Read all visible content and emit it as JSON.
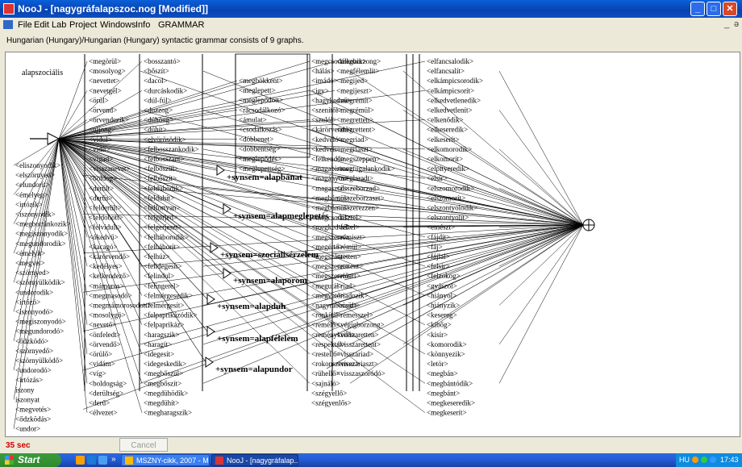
{
  "window": {
    "title": "NooJ - [nagygráfalapszoc.nog [Modified]]"
  },
  "menu": [
    "File",
    "Edit",
    "Lab",
    "Project",
    "Windows",
    "Info",
    "GRAMMAR"
  ],
  "mdi_controls": {
    "minimize": "_",
    "restore": "ə"
  },
  "info_text": "Hungarian (Hungary)/Hungarian (Hungary) syntactic grammar consists of 9 graphs.",
  "graph": {
    "start_label": "alapszociális",
    "columns": [
      [
        "<eliszonyodik>",
        "<elszörnyed>",
        "<elundorít>",
        "<émelyeg>",
        "<irtózik>",
        "<iszonyodik>",
        "<megbotránkozik>",
        "<megiszonyodik>",
        "<megundorodik>",
        "<émelyít>",
        "<megvet>",
        "<szörnyed>",
        "<szörnyülködik>",
        "<undorodik>",
        "<irtózó>",
        "<iszonyodó>",
        "<megiszonyodó>",
        "<megundorodó>",
        "<ődzködó>",
        "<szörnyedő>",
        "<szörnyülködő>",
        "<undorodó>",
        "<irtózás>",
        "iszony",
        "iszonyat",
        "<megvetés>",
        "<ődzködás>",
        "<undor>"
      ],
      [
        "<megörül>",
        "<mosolyog>",
        "<nevettet>",
        "<nevetgél>",
        "<örül>",
        "<örvend>",
        "<örvendezik>",
        "<ujjong>",
        "<vidul>",
        "<vidít>",
        "<vigad>",
        "<visszanevet>",
        "<boldog>",
        "<derült>",
        "<derűs>",
        "<felderült>",
        "<feldobott>",
        "<felvidult>",
        "<ókedvű>",
        "<kacagó>",
        "<kárörvendő>",
        "<kedélyes>",
        "<kelkendező>",
        "<mámoros>",
        "<megmasodó>",
        "<megmámorosodott>",
        "<mosolygó>",
        "<nevető>",
        "<önfeledt>",
        "<örvendő>",
        "<örülő>",
        "<vidám>",
        "<víg>",
        "<boldogság>",
        "<derültség>",
        "<derű>",
        "<élvezet>"
      ],
      [
        "<bosszantó>",
        "<bőszít>",
        "<dacol>",
        "<durcáskodik>",
        "<dúl-fúl>",
        "<duzzog>",
        "<dühöng>",
        "<dühít>",
        "<elvörösödik>",
        "<felbosszankodik>",
        "<felbosszant>",
        "<felbőszül>",
        "<felbőszít>",
        "<feldühödik>",
        "<felduhít>",
        "<felfortyan>",
        "<felgerjed>",
        "<felgerjeszt>",
        "<felháborodik>",
        "<felháborít>",
        "<felhúz>",
        "<felidegesít>",
        "<felindul>",
        "<felingerel>",
        "<felmérgesedik>",
        "<felmérgesít>",
        "<felpaprikázódik>",
        "<felpaprikáz>",
        "<haragszik>",
        "<haragít>",
        "<idegesít>",
        "<idegeskedik>",
        "<megbőszül>",
        "<megbőszít>",
        "<megdühödik>",
        "<megdühít>",
        "<megharagszik>"
      ],
      [
        "<megbökkent>",
        "<meglepett>",
        "<meglepődött>",
        "<rácsodálkozó>",
        "<ámulat>",
        "<csodálkozás>",
        "<döbbenet>",
        "<döbbentség>",
        "<meglepődés>",
        "<meglepettség>"
      ],
      [
        "<megcsodálkozik>",
        "<hálás>",
        "<imádó>",
        "<igy>",
        "<hagykedvű>",
        "<szenitől>",
        "<szulól>",
        "<kárörvendő>",
        "<kedveló>",
        "<kedvelt>",
        "<feikendő>",
        "<magabiztos>",
        "<magányos>",
        "<magasztal>",
        "<megbámul>",
        "<megbámul>",
        "<megcsodál>",
        "<megkedvel>",
        "<megszeret>",
        "<megértő>",
        "<megszánt>",
        "<megszeret>",
        "<megszerető>",
        "<megutál>",
        "<megvető>",
        "<nagyrabecsül>",
        "<ronkítál>",
        "<remélő>",
        "<reménykedő>",
        "<respektál>",
        "<restellő>",
        "<rokonszenvez>",
        "<rühellő>",
        "<sajnáló>",
        "<szégyellő>",
        "<szégyenlős>"
      ],
      [
        "<megborzong>",
        "<megfélemlít>",
        "<megijed>",
        "<megijeszt>",
        "<megrémít>",
        "<megrémül>",
        "<megretten>",
        "<megrettent>",
        "<megriad>",
        "<megriaszt>",
        "<megszeppen>",
        "<megtugalankodik>",
        "<meglaradt>",
        "<összeborzad>",
        "<összeborzaszt>",
        "<összerezzen>",
        "<tisztel>",
        "<féltel>",
        "<rémiszt>",
        "<rémül>",
        "<retten>",
        "<rettent>",
        "<riaszt>",
        "<riad>",
        "<riadozik>",
        "<riaszt>",
        "<rémesszel>",
        "<végigborzong>",
        "<visszaretten>",
        "<visszarettent>",
        "<visszariad>",
        "<visszariaszt>",
        "<visszaszoródó>"
      ],
      [
        "<elfancsalodik>",
        "<elfancsalít>",
        "<elkámpicsorodik>",
        "<elkámpicsorít>",
        "<elkedvetlenedik>",
        "<elkedvetlenít>",
        "<elkenődik>",
        "<elkeseredik>",
        "<elkeserít>",
        "<elkomorodik>",
        "<elkomorít>",
        "<elpityeredik>",
        "<elsír>",
        "<elszomorodik>",
        "<elszomorít>",
        "<elszontyolodik>",
        "<elszontyolít>",
        "<emészt>",
        "<fájdít>",
        "<fáj>",
        "<fájlal>",
        "<felsír>",
        "<felzokog>",
        "<gyászol>",
        "<hiányol>",
        "<hiányzik>",
        "<kesereg>",
        "<kibőg>",
        "<kisír>",
        "<komorodik>",
        "<könnyezik>",
        "<letör>",
        "<megbán>",
        "<megbántódik>",
        "<megbánt>",
        "<megkeseredik>",
        "<megkeserít>"
      ]
    ],
    "subgraphs": [
      "+synsem=alapbánat",
      "+synsem=alapmeglepetés",
      "+synsem=szociálisérzelem",
      "+synsem=alaporom",
      "+synsem=alapduh",
      "+synsem=alapfélelem",
      "+synsem=alapundor"
    ]
  },
  "status": {
    "timer": "35 sec",
    "cancel_label": "Cancel"
  },
  "taskbar": {
    "start_label": "Start",
    "quicklaunch_more": "»",
    "tasks": [
      "MSZNY-cikk, 2007 - M...",
      "NooJ - [nagygráfalap..."
    ],
    "language": "HU",
    "clock": "17:43"
  },
  "colors": {
    "titlebar": "#0a54c8",
    "canvas": "#ffffff",
    "text": "#000000",
    "timer": "#d10000"
  }
}
